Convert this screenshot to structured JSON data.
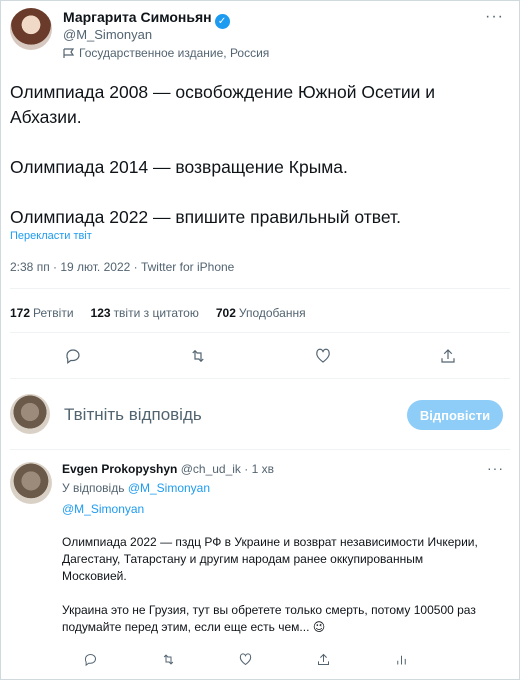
{
  "tweet": {
    "author_name": "Маргарита Симоньян",
    "author_handle": "@M_Simonyan",
    "label": "Государственное издание, Россия",
    "paragraphs": [
      "Олимпиада 2008 — освобождение Южной Осетии и Абхазии.",
      "Олимпиада 2014 — возвращение Крыма.",
      "Олимпиада 2022 — впишите правильный ответ."
    ],
    "translate": "Перекласти твіт",
    "meta": "2:38 пп · 19 лют. 2022 · Twitter for iPhone",
    "stats": [
      {
        "count": "172",
        "label": "Ретвіти"
      },
      {
        "count": "123",
        "label": "твіти з цитатою"
      },
      {
        "count": "702",
        "label": "Уподобання"
      }
    ]
  },
  "composer": {
    "placeholder": "Твітніть відповідь",
    "button": "Відповісти"
  },
  "reply": {
    "author_name": "Evgen Prokopyshyn",
    "author_handle": "@ch_ud_ik",
    "time": "· 1 хв",
    "replying_prefix": "У відповідь",
    "replying_handle": "@M_Simonyan",
    "mention": "@M_Simonyan",
    "paragraphs": [
      "Олимпиада 2022 — пздц РФ в Украине и возврат независимости Ичкерии, Дагестану, Татарстану и другим народам ранее оккупированным Московией.",
      "Украина это не Грузия, тут вы обретете только смерть, потому 100500 раз подумайте перед этим, если еще есть чем... 😉"
    ]
  },
  "icons": {
    "verified": "verified-badge-icon",
    "more": "more-dots-icon",
    "label": "state-media-flag-icon",
    "actions": [
      "reply-icon",
      "retweet-icon",
      "like-icon",
      "share-icon",
      "analytics-icon"
    ]
  },
  "colors": {
    "accent": "#1d9bf0",
    "text": "#0f1419",
    "muted": "#536471",
    "reply_button_disabled": "#8ecdf7"
  }
}
